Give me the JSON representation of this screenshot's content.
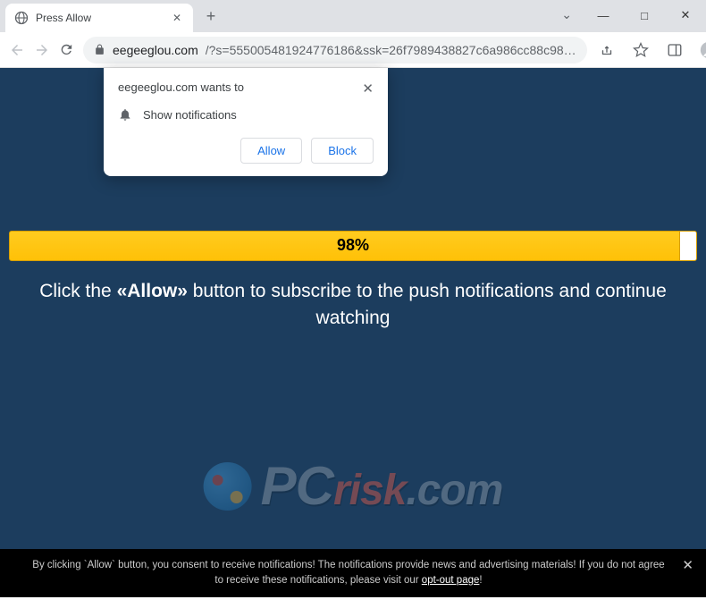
{
  "window": {
    "chevron": "⌄",
    "minimize": "—",
    "maximize": "□",
    "close": "✕"
  },
  "tab": {
    "title": "Press Allow",
    "close": "✕"
  },
  "toolbar": {
    "url_host": "eegeeglou.com",
    "url_rest": "/?s=555005481924776186&ssk=26f7989438827c6a986cc88c98…",
    "newtab": "+"
  },
  "permission": {
    "title": "eegeeglou.com wants to",
    "line": "Show notifications",
    "allow": "Allow",
    "block": "Block",
    "close": "✕"
  },
  "page": {
    "progress": "98%",
    "text_before": "Click the ",
    "text_allow": "«Allow»",
    "text_after": " button to subscribe to the push notifications and continue watching"
  },
  "watermark": {
    "pc": "PC",
    "risk": "risk",
    "com": ".com"
  },
  "consent": {
    "text1": "By clicking `Allow` button, you consent to receive notifications! The notifications provide news and advertising materials! If you do not agree to receive these notifications, please visit our ",
    "opt": "opt-out page",
    "text2": "!",
    "close": "✕"
  }
}
